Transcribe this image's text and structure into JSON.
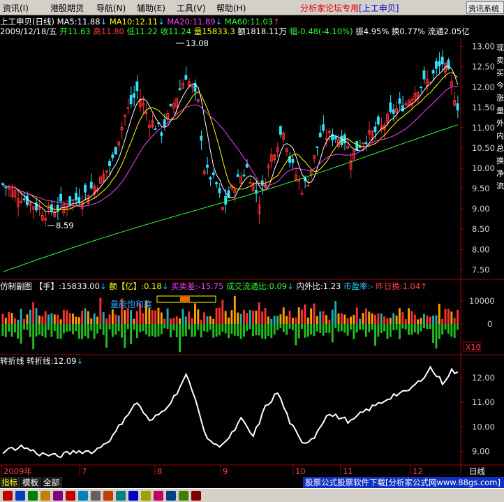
{
  "menu": {
    "items": [
      "资讯(I)",
      "港股期货",
      "导航(N)",
      "辅助(E)",
      "工具(V)",
      "帮助(H)"
    ],
    "title": "分析家论坛专用",
    "stock_tag": "[上工申贝]",
    "right_button": "资讯系统"
  },
  "quote": {
    "name": "上工申贝(日线)",
    "ma5": "MA5:11.88",
    "ma10": "MA10:12.11",
    "ma20": "MA20:11.89",
    "ma60": "MA60:11.03",
    "date": "2009/12/18/五",
    "open": "开11.63",
    "high": "高11.80",
    "low": "低11.22",
    "close": "收11.24",
    "volume": "量15833.3",
    "amount": "额1818.11万",
    "change": "幅-0.48(-4.10%)",
    "amplitude": "振4.95%",
    "turnover": "换0.77%",
    "float": "流通2.05亿"
  },
  "price_chart": {
    "y_ticks": [
      "13.00",
      "12.50",
      "12.00",
      "11.50",
      "11.00",
      "10.50",
      "10.00",
      "9.50",
      "9.00",
      "8.50",
      "8.00",
      "7.50"
    ],
    "high_marker": "13.08",
    "low_marker": "8.59",
    "colors": {
      "up": "#ff3030",
      "down": "#30e0ff",
      "ma5": "#ffffff",
      "ma10": "#ffff00",
      "ma20": "#ff40ff",
      "ma60": "#30ff30"
    }
  },
  "volume_panel": {
    "title": "仿制副图",
    "shou": "【手】:15833.00",
    "e": "额【亿】:0.18",
    "maimaicha": "买卖差:-15.75",
    "liutong": "成交流通比:0.09",
    "neiwaibi": "内外比:1.23",
    "shiyinglv": "市盈率:-",
    "zuorihuan": "昨日换:1.04",
    "overlay_label": "量能饱和度",
    "y_ticks": [
      "10000",
      "0"
    ],
    "scale_label": "X10"
  },
  "indicator_panel": {
    "title": "转折线",
    "value_label": "转折线:12.09",
    "y_ticks": [
      "12.00",
      "11.00",
      "10.00",
      "9.00"
    ]
  },
  "x_axis": {
    "labels": [
      "2009年",
      "7",
      "8",
      "9",
      "10",
      "11",
      "12"
    ],
    "period": "日线"
  },
  "bottom_tabs": [
    "指标",
    "模板",
    "全部"
  ],
  "footer_ad": "股票公式股票软件下载[分析家公式网www.88gs.com]",
  "right_side_labels": [
    "现",
    "卖",
    "买",
    "今",
    "涨",
    "量",
    "外",
    "内",
    "总",
    "换",
    "净",
    "流"
  ],
  "chart_data": {
    "type": "candlestick",
    "title": "上工申贝(日线)",
    "ylim": [
      7.3,
      13.2
    ],
    "x_months": [
      "2009年",
      "7",
      "8",
      "9",
      "10",
      "11",
      "12"
    ],
    "indicator": {
      "name": "转折线",
      "last": 12.09
    }
  }
}
